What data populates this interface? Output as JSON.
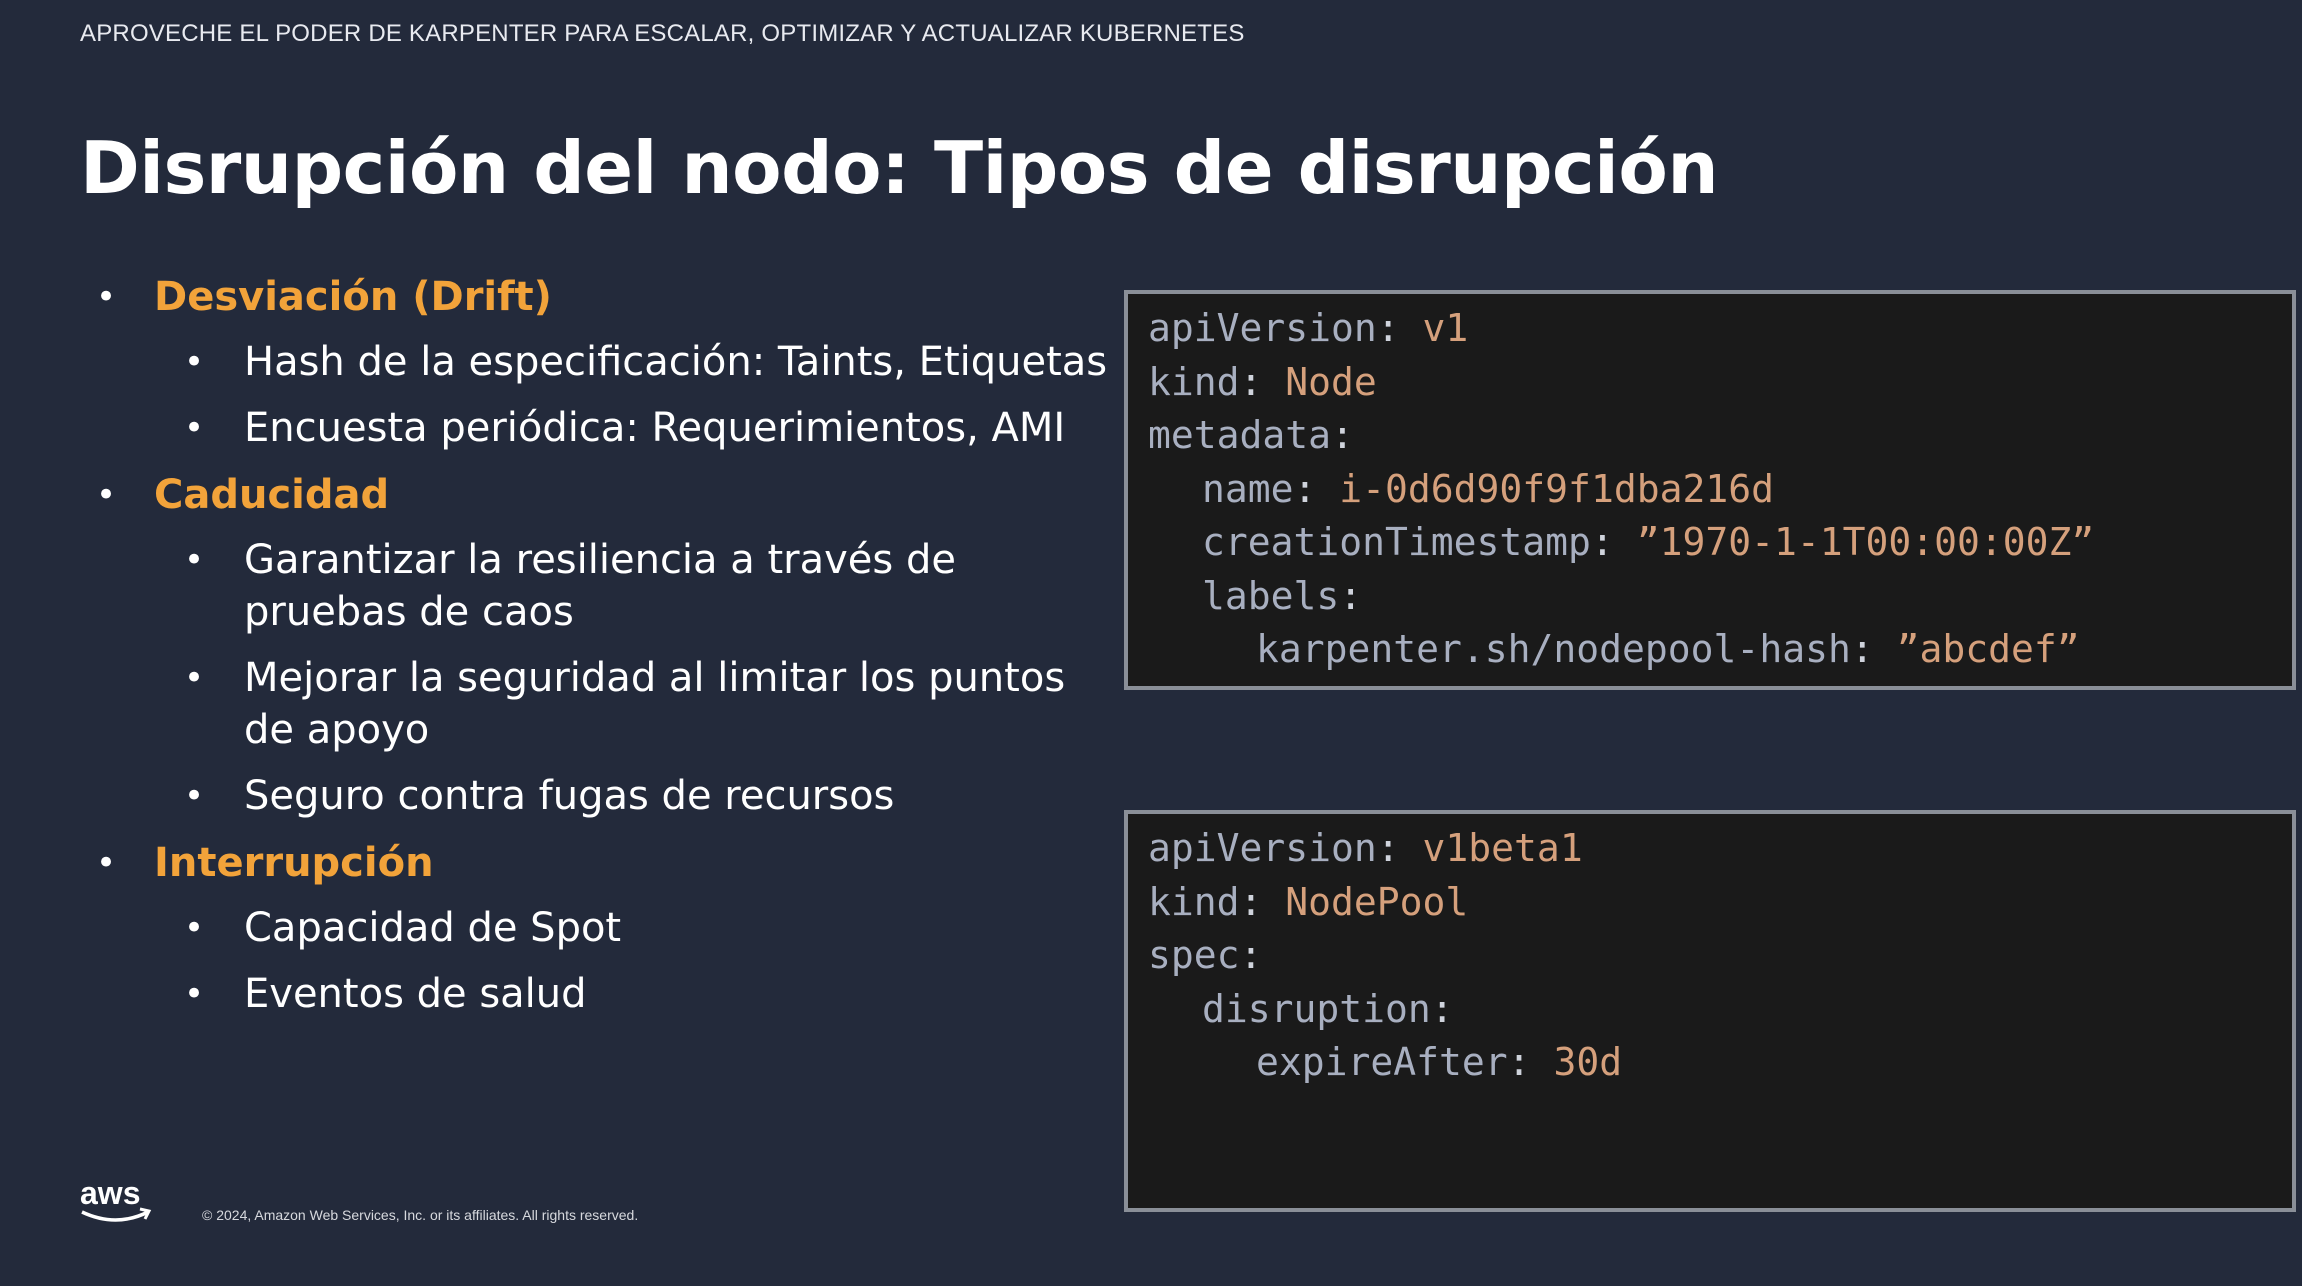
{
  "header": "APROVECHE EL PODER DE KARPENTER PARA ESCALAR, OPTIMIZAR Y ACTUALIZAR KUBERNETES",
  "title": "Disrupción del nodo: Tipos de disrupción",
  "bullets": {
    "drift": {
      "heading": "Desviación (Drift)",
      "items": [
        "Hash de la especificación: Taints, Etiquetas",
        "Encuesta periódica: Requerimientos, AMI"
      ]
    },
    "expiration": {
      "heading": "Caducidad",
      "items": [
        "Garantizar la resiliencia a través de pruebas de caos",
        "Mejorar la seguridad al limitar los puntos de apoyo",
        "Seguro contra fugas de recursos"
      ]
    },
    "interruption": {
      "heading": "Interrupción",
      "items": [
        "Capacidad de Spot",
        "Eventos de salud"
      ]
    }
  },
  "code_node": {
    "apiVersion_key": "apiVersion",
    "apiVersion_val": "v1",
    "kind_key": "kind",
    "kind_val": "Node",
    "metadata_key": "metadata",
    "name_key": "name",
    "name_val": "i-0d6d90f9f1dba216d",
    "ts_key": "creationTimestamp",
    "ts_val": "”1970-1-1T00:00:00Z”",
    "labels_key": "labels",
    "hash_key": "karpenter.sh/nodepool-hash",
    "hash_val": "”abcdef”"
  },
  "code_nodepool": {
    "apiVersion_key": "apiVersion",
    "apiVersion_val": "v1beta1",
    "kind_key": "kind",
    "kind_val": "NodePool",
    "spec_key": "spec",
    "disruption_key": "disruption",
    "expire_key": "expireAfter",
    "expire_val": "30d"
  },
  "footer": {
    "logo_text": "aws",
    "copyright": "© 2024, Amazon Web Services, Inc. or its affiliates. All rights reserved."
  },
  "colors": {
    "background": "#232a3b",
    "heading_accent": "#f2a33a",
    "code_bg": "#1a1a1a",
    "code_key": "#a8afc0",
    "code_value": "#d5a07c"
  }
}
